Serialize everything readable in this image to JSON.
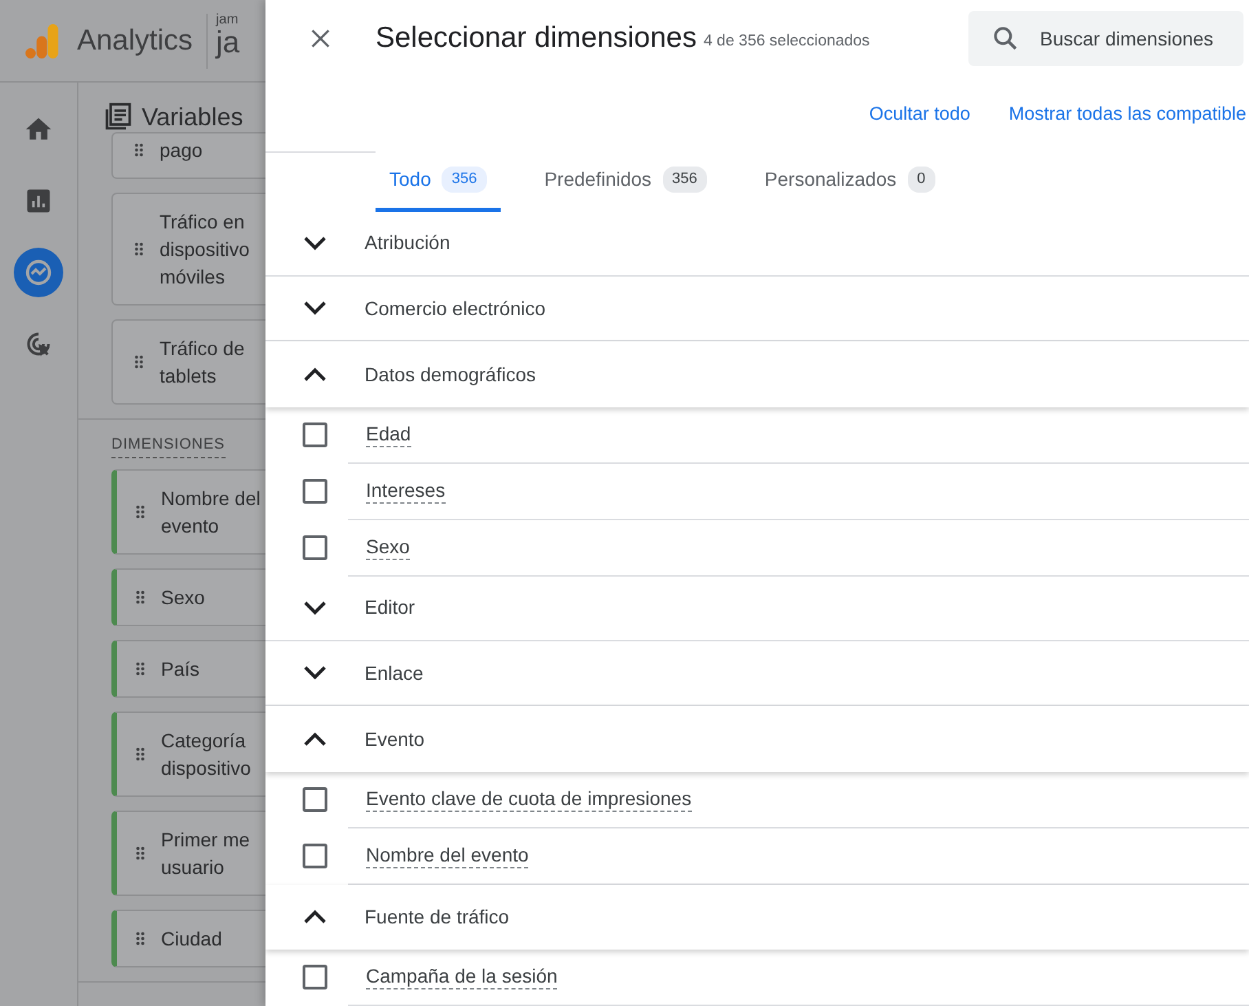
{
  "app": {
    "name": "Analytics",
    "account_small": "jam",
    "account": "ja"
  },
  "rail": [
    {
      "selected": false
    },
    {
      "selected": false
    },
    {
      "selected": true
    },
    {
      "selected": false
    }
  ],
  "variables": {
    "title": "Variables",
    "top_cards": [
      {
        "lines": [
          "pago"
        ]
      },
      {
        "lines": [
          "Tráfico en",
          "dispositivo",
          "móviles"
        ]
      },
      {
        "lines": [
          "Tráfico de",
          "tablets"
        ]
      }
    ],
    "dimensions_heading": "DIMENSIONES",
    "dimension_cards": [
      {
        "lines": [
          "Nombre del",
          "evento"
        ]
      },
      {
        "lines": [
          "Sexo"
        ]
      },
      {
        "lines": [
          "País"
        ]
      },
      {
        "lines": [
          "Categoría",
          "dispositivo"
        ]
      },
      {
        "lines": [
          "Primer me",
          "usuario"
        ]
      },
      {
        "lines": [
          "Ciudad"
        ]
      }
    ]
  },
  "dialog": {
    "title": "Seleccionar dimensiones",
    "subtitle": "4 de 356 seleccionados",
    "search": {
      "placeholder": "Buscar dimensiones"
    },
    "links": [
      "Ocultar todo",
      "Mostrar todas las compatible"
    ],
    "tabs": [
      {
        "label": "Todo",
        "count": "356",
        "selected": true
      },
      {
        "label": "Predefinidos",
        "count": "356",
        "selected": false
      },
      {
        "label": "Personalizados",
        "count": "0",
        "selected": false
      }
    ],
    "rows": [
      {
        "kind": "category",
        "label": "Atribución",
        "expanded": false
      },
      {
        "kind": "category",
        "label": "Comercio electrónico",
        "expanded": false
      },
      {
        "kind": "category",
        "label": "Datos demográficos",
        "expanded": true
      },
      {
        "kind": "item",
        "label": "Edad",
        "checked": false
      },
      {
        "kind": "item",
        "label": "Intereses",
        "checked": false
      },
      {
        "kind": "item",
        "label": "Sexo",
        "checked": false
      },
      {
        "kind": "category",
        "label": "Editor",
        "expanded": false
      },
      {
        "kind": "category",
        "label": "Enlace",
        "expanded": false
      },
      {
        "kind": "category",
        "label": "Evento",
        "expanded": true
      },
      {
        "kind": "item",
        "label": "Evento clave de cuota de impresiones",
        "checked": false
      },
      {
        "kind": "item",
        "label": "Nombre del evento",
        "checked": false
      },
      {
        "kind": "category",
        "label": "Fuente de tráfico",
        "expanded": true
      },
      {
        "kind": "item",
        "label": "Campaña de la sesión",
        "checked": false
      }
    ]
  }
}
